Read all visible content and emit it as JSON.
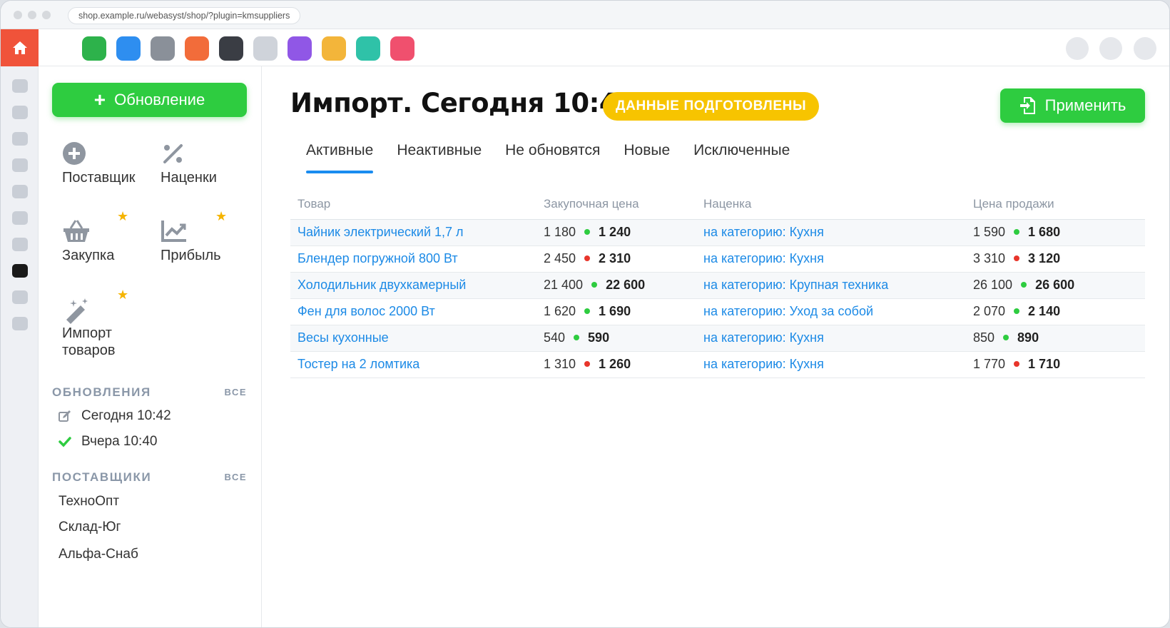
{
  "browser": {
    "url": "shop.example.ru/webasyst/shop/?plugin=kmsuppliers"
  },
  "appbar": {
    "home_icon": "home-icon",
    "app_colors": [
      "#2db24b",
      "#2e8ef0",
      "#8a9099",
      "#f26c3a",
      "#3a3d44",
      "#cfd3da",
      "#9057e6",
      "#f3b53a",
      "#2fc2a8",
      "#f0506e"
    ]
  },
  "sidebar": {
    "update_button": "Обновление",
    "tools": [
      {
        "label": "Поставщик",
        "icon": "plus-circle-icon",
        "starred": false
      },
      {
        "label": "Наценки",
        "icon": "percent-icon",
        "starred": false
      },
      {
        "label": "Закупка",
        "icon": "basket-icon",
        "starred": true
      },
      {
        "label": "Прибыль",
        "icon": "chart-up-icon",
        "starred": true
      },
      {
        "label": "Импорт товаров",
        "icon": "magic-wand-icon",
        "starred": true
      }
    ],
    "updates_title": "ОБНОВЛЕНИЯ",
    "updates_all": "ВСЕ",
    "updates": [
      {
        "label": "Сегодня 10:42",
        "icon": "edit-icon"
      },
      {
        "label": "Вчера 10:40",
        "icon": "check-icon"
      }
    ],
    "suppliers_title": "ПОСТАВЩИКИ",
    "suppliers_all": "ВСЕ",
    "suppliers": [
      "ТехноОпт",
      "Склад-Юг",
      "Альфа-Снаб"
    ]
  },
  "main": {
    "title": "Импорт. Сегодня 10:42",
    "status_badge": "ДАННЫЕ ПОДГОТОВЛЕНЫ",
    "apply_button": "Применить",
    "tabs": [
      "Активные",
      "Неактивные",
      "Не обновятся",
      "Новые",
      "Исключенные"
    ],
    "active_tab": "Активные",
    "columns": [
      "Товар",
      "Закупочная цена",
      "Наценка",
      "Цена продажи"
    ],
    "rows": [
      {
        "product": "Чайник электрический 1,7 л",
        "buy_old": "1 180",
        "buy_new": "1 240",
        "markup": "на категорию: Кухня",
        "sell_old": "1 590",
        "sell_new": "1 680",
        "trend": "green"
      },
      {
        "product": "Блендер погружной 800 Вт",
        "buy_old": "2 450",
        "buy_new": "2 310",
        "markup": "на категорию: Кухня",
        "sell_old": "3 310",
        "sell_new": "3 120",
        "trend": "red"
      },
      {
        "product": "Холодильник двухкамерный",
        "buy_old": "21 400",
        "buy_new": "22 600",
        "markup": "на категорию: Крупная техника",
        "sell_old": "26 100",
        "sell_new": "26 600",
        "trend": "green"
      },
      {
        "product": "Фен для волос 2000 Вт",
        "buy_old": "1 620",
        "buy_new": "1 690",
        "markup": "на категорию: Уход за собой",
        "sell_old": "2 070",
        "sell_new": "2 140",
        "trend": "green"
      },
      {
        "product": "Весы кухонные",
        "buy_old": "540",
        "buy_new": "590",
        "markup": "на категорию: Кухня",
        "sell_old": "850",
        "sell_new": "890",
        "trend": "green"
      },
      {
        "product": "Тостер на 2 ломтика",
        "buy_old": "1 310",
        "buy_new": "1 260",
        "markup": "на категорию: Кухня",
        "sell_old": "1 770",
        "sell_new": "1 710",
        "trend": "red"
      }
    ]
  },
  "colors": {
    "accent_green": "#2ecc40",
    "badge_yellow": "#f7c400",
    "link_blue": "#1c8ae6",
    "dot_green": "#2ecc40",
    "dot_red": "#e8352b",
    "home_red": "#f0533a"
  }
}
